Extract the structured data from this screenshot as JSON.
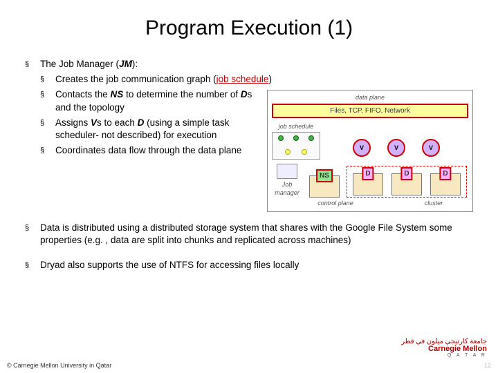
{
  "title": "Program Execution (1)",
  "b1_prefix": "The Job Manager (",
  "b1_jm": "JM",
  "b1_suffix": "):",
  "s1_prefix": "Creates the job communication graph (",
  "s1_link": "job schedule",
  "s1_suffix": ")",
  "s2a": "Contacts the ",
  "s2b": "NS",
  "s2c": " to determine the number of ",
  "s2d": "D",
  "s2e": "s and the topology",
  "s3a": "Assigns ",
  "s3b": "V",
  "s3c": "s to each ",
  "s3d": "D",
  "s3e": " (using a simple task scheduler- not described) for execution",
  "s4": "Coordinates data flow through the data plane",
  "b2": "Data is distributed using a distributed storage system that shares with the Google File System some properties (e.g. , data are split into chunks and replicated across machines)",
  "b3": "Dryad also supports the use of NTFS for accessing files locally",
  "diagram": {
    "data_plane": "data plane",
    "dp_content": "Files, TCP, FIFO, Network",
    "job_schedule": "job schedule",
    "V": "V",
    "job_manager": "Job manager",
    "NS": "NS",
    "D": "D",
    "control_plane": "control plane",
    "cluster": "cluster"
  },
  "footer": "© Carnegie Mellon University in Qatar",
  "page": "12",
  "logo_en": "Carnegie Mellon",
  "logo_sub": "Q A T A R"
}
